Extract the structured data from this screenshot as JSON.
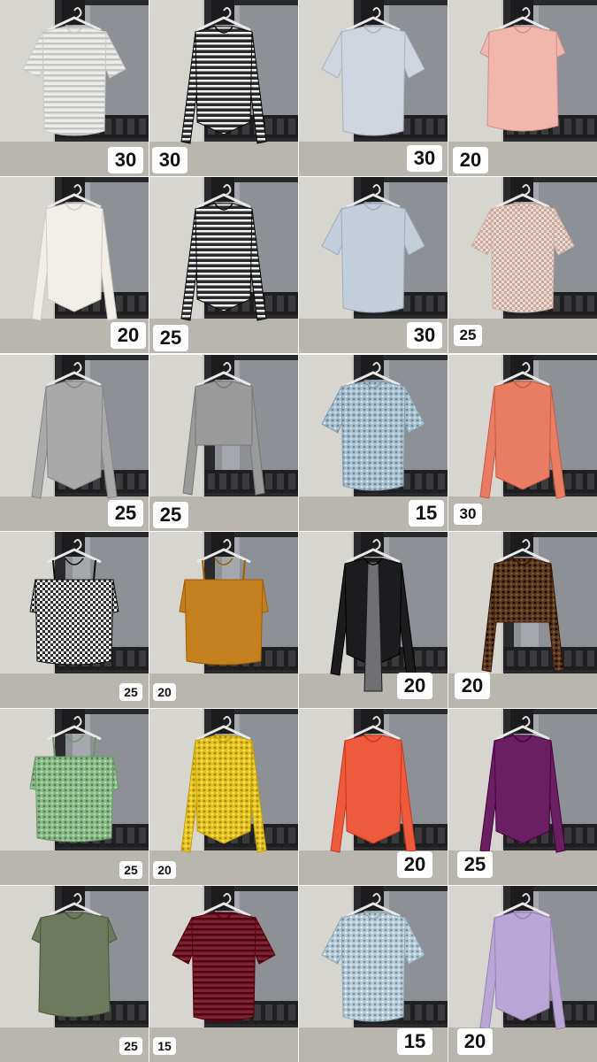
{
  "photos": [
    {
      "id": "p1",
      "garment": "white-shirt",
      "price": "30",
      "color": "#ececea",
      "pattern": "stripe"
    },
    {
      "id": "p2",
      "garment": "striped-crop-top",
      "price": "30",
      "color": "#2a2a2a",
      "pattern": "stripe"
    },
    {
      "id": "p3",
      "garment": "light-blue-blouse",
      "price": "30",
      "color": "#cfd6df",
      "pattern": "plain"
    },
    {
      "id": "p4",
      "garment": "pink-blouse",
      "price": "20",
      "color": "#f1b6ac",
      "pattern": "plain"
    },
    {
      "id": "p5",
      "garment": "white-long-sleeve-top",
      "price": "20",
      "color": "#f1efe8",
      "pattern": "plain"
    },
    {
      "id": "p6",
      "garment": "striped-long-sleeve-top",
      "price": "25",
      "color": "#2b2b2b",
      "pattern": "stripe"
    },
    {
      "id": "p7",
      "garment": "blue-shirt",
      "price": "30",
      "color": "#c3cedb",
      "pattern": "plain"
    },
    {
      "id": "p8",
      "garment": "checked-pajama-shirt",
      "price": "25",
      "color": "#f1d7cc",
      "pattern": "check"
    },
    {
      "id": "p9",
      "garment": "grey-long-sleeve-top",
      "price": "25",
      "color": "#a9a9a9",
      "pattern": "plain"
    },
    {
      "id": "p10",
      "garment": "grey-crop-top",
      "price": "25",
      "color": "#9a9a9a",
      "pattern": "plain"
    },
    {
      "id": "p11",
      "garment": "light-blue-print-tee",
      "price": "15",
      "color": "#a9c1d0",
      "pattern": "dots"
    },
    {
      "id": "p12",
      "garment": "coral-blouse",
      "price": "30",
      "color": "#e97c62",
      "pattern": "plain"
    },
    {
      "id": "p13",
      "garment": "gingham-off-shoulder-top",
      "price": "25",
      "color": "#303030",
      "pattern": "check"
    },
    {
      "id": "p14",
      "garment": "mustard-ruffle-top",
      "price": "20",
      "color": "#c4801f",
      "pattern": "plain"
    },
    {
      "id": "p15",
      "garment": "black-cardigan",
      "price": "20",
      "color": "#1c1c1e",
      "pattern": "plain"
    },
    {
      "id": "p16",
      "garment": "brown-print-crop-top",
      "price": "20",
      "color": "#5a3a1e",
      "pattern": "dots"
    },
    {
      "id": "p17",
      "garment": "floral-ruffle-top",
      "price": "25",
      "color": "#8dbb8c",
      "pattern": "dots"
    },
    {
      "id": "p18",
      "garment": "yellow-floral-blouse",
      "price": "20",
      "color": "#e5c329",
      "pattern": "dots"
    },
    {
      "id": "p19",
      "garment": "orange-sport-top",
      "price": "20",
      "color": "#ee5a3c",
      "pattern": "plain"
    },
    {
      "id": "p20",
      "garment": "purple-long-sleeve-top",
      "price": "25",
      "color": "#6a1f62",
      "pattern": "plain"
    },
    {
      "id": "p21",
      "garment": "green-ruffle-top",
      "price": "25",
      "color": "#6d7a5e",
      "pattern": "plain"
    },
    {
      "id": "p22",
      "garment": "chevron-print-blouse",
      "price": "15",
      "color": "#7a2436",
      "pattern": "stripe"
    },
    {
      "id": "p23",
      "garment": "light-blue-print-tee",
      "price": "15",
      "color": "#b7ccd8",
      "pattern": "dots"
    },
    {
      "id": "p24",
      "garment": "lavender-long-sleeve-top",
      "price": "20",
      "color": "#b9a6d6",
      "pattern": "plain"
    }
  ]
}
